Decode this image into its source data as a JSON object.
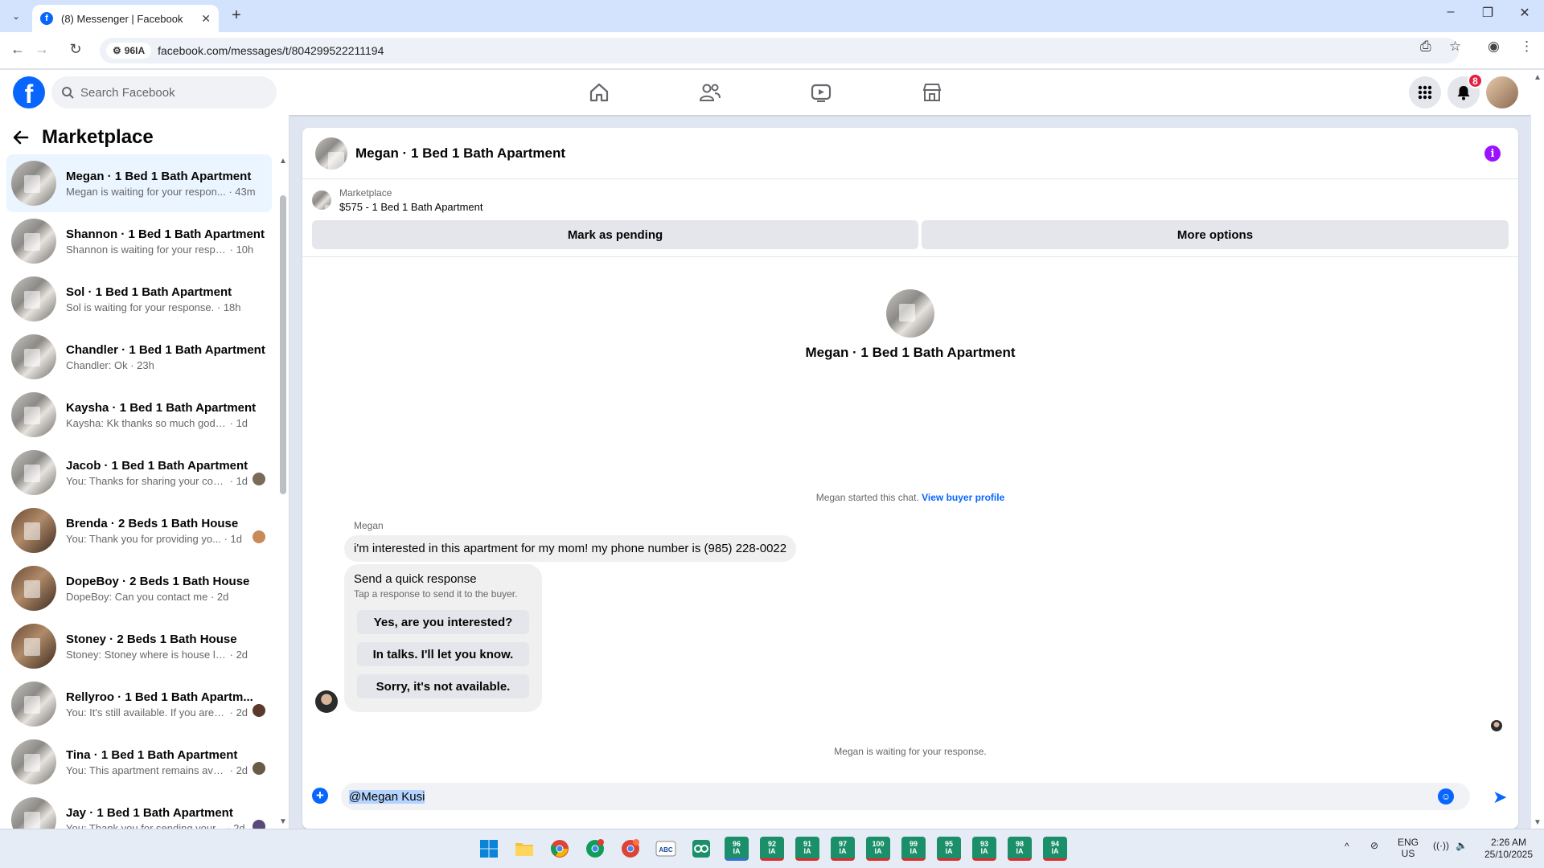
{
  "browser": {
    "tab_title": "(8) Messenger | Facebook",
    "url": "facebook.com/messages/t/804299522211194",
    "site_label": "96IA"
  },
  "header": {
    "search_placeholder": "Search Facebook",
    "notifications_count": "8",
    "brand_color": "#0866ff"
  },
  "sidebar": {
    "title": "Marketplace",
    "conversations": [
      {
        "title": "Megan · 1 Bed 1 Bath Apartment",
        "preview": "Megan is waiting for your respon...",
        "time": "· 43m",
        "active": true
      },
      {
        "title": "Shannon · 1 Bed 1 Bath Apartment",
        "preview": "Shannon is waiting for your respo...",
        "time": "· 10h"
      },
      {
        "title": "Sol · 1 Bed 1 Bath Apartment",
        "preview": "Sol is waiting for your response.",
        "time": "· 18h"
      },
      {
        "title": "Chandler · 1 Bed 1 Bath Apartment",
        "preview": "Chandler: Ok",
        "time": "· 23h"
      },
      {
        "title": "Kaysha · 1 Bed 1 Bath Apartment",
        "preview": "Kaysha: Kk thanks so much god ble...",
        "time": "· 1d"
      },
      {
        "title": "Jacob · 1 Bed 1 Bath Apartment",
        "preview": "You: Thanks for sharing your con...",
        "time": "· 1d"
      },
      {
        "title": "Brenda · 2 Beds 1 Bath House",
        "preview": "You: Thank you for providing yo...",
        "time": "· 1d"
      },
      {
        "title": "DopeBoy · 2 Beds 1 Bath House",
        "preview": "DopeBoy: Can you contact me",
        "time": "· 2d"
      },
      {
        "title": "Stoney · 2 Beds 1 Bath House",
        "preview": "Stoney: Stoney where is house loca...",
        "time": "· 2d"
      },
      {
        "title": "Rellyroo · 1 Bed 1 Bath Apartm...",
        "preview": "You: It's still available. If you are i...",
        "time": "· 2d"
      },
      {
        "title": "Tina · 1 Bed 1 Bath Apartment",
        "preview": "You: This apartment remains ava...",
        "time": "· 2d"
      },
      {
        "title": "Jay · 1 Bed 1 Bath Apartment",
        "preview": "You: Thank you for sending your...",
        "time": "· 2d"
      }
    ]
  },
  "chat": {
    "title": "Megan · 1 Bed 1 Bath Apartment",
    "marketplace_label": "Marketplace",
    "listing": "$575 - 1 Bed 1 Bath Apartment",
    "mark_pending": "Mark as pending",
    "more_options": "More options",
    "profile_name": "Megan · 1 Bed 1 Bath Apartment",
    "started_text": "Megan started this chat.",
    "view_profile": "View buyer profile",
    "sender": "Megan",
    "message": "i'm interested in this apartment for my mom! my phone number is (985) 228-0022",
    "quick_title": "Send a quick response",
    "quick_sub": "Tap a response to send it to the buyer.",
    "quick_responses": [
      "Yes, are you interested?",
      "In talks. I'll let you know.",
      "Sorry, it's not available."
    ],
    "waiting": "Megan is waiting for your response.",
    "compose_text": "@Megan Kusi"
  },
  "taskbar": {
    "apps": [
      "96\nIA",
      "92\nIA",
      "91\nIA",
      "97\nIA",
      "100\nIA",
      "99\nIA",
      "95\nIA",
      "93\nIA",
      "98\nIA",
      "94\nIA"
    ],
    "lang": "ENG",
    "region": "US",
    "time": "2:26 AM",
    "date": "25/10/2025"
  }
}
